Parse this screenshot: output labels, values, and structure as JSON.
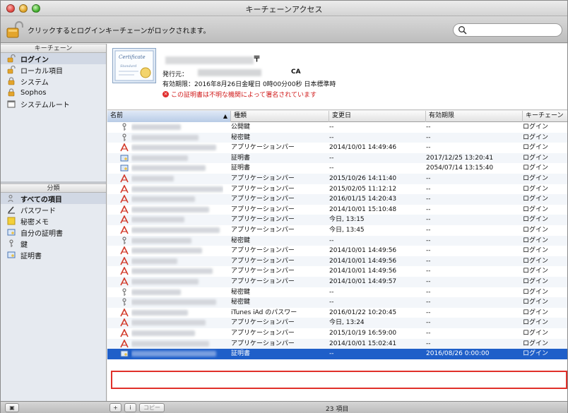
{
  "window": {
    "title": "キーチェーンアクセス"
  },
  "toolbar": {
    "lock_message": "クリックするとログインキーチェーンがロックされます。",
    "search_placeholder": "",
    "search_icon": "magnifier-icon"
  },
  "sidebar": {
    "keychains_header": "キーチェーン",
    "keychains": [
      {
        "label": "ログイン",
        "icon": "unlocked-padlock-icon",
        "selected": true
      },
      {
        "label": "ローカル項目",
        "icon": "unlocked-padlock-icon",
        "selected": false
      },
      {
        "label": "システム",
        "icon": "locked-padlock-icon",
        "selected": false
      },
      {
        "label": "Sophos",
        "icon": "locked-padlock-icon",
        "selected": false
      },
      {
        "label": "システムルート",
        "icon": "folder-icon",
        "selected": false
      }
    ],
    "category_header": "分類",
    "categories": [
      {
        "label": "すべての項目",
        "icon": "people-icon",
        "selected": true
      },
      {
        "label": "パスワード",
        "icon": "pencil-icon",
        "selected": false
      },
      {
        "label": "秘密メモ",
        "icon": "note-icon",
        "selected": false
      },
      {
        "label": "自分の証明書",
        "icon": "certificate-icon",
        "selected": false
      },
      {
        "label": "鍵",
        "icon": "key-icon",
        "selected": false
      },
      {
        "label": "証明書",
        "icon": "certificate-icon",
        "selected": false
      }
    ]
  },
  "detail": {
    "name_suffix": "〒",
    "issuer_label": "発行元：",
    "issuer_suffix": "CA",
    "expiry": "有効期限：2016年8月26日金曜日 0時00分00秒 日本標準時",
    "warning": "この証明書は不明な機関によって署名されています",
    "warning_icon": "warning-icon"
  },
  "table": {
    "columns": {
      "name": "名前",
      "kind": "種類",
      "modified": "変更日",
      "expires": "有効期限",
      "keychain": "キーチェーン"
    },
    "rows": [
      {
        "icon": "key-icon",
        "kind": "公開鍵",
        "modified": "--",
        "expires": "--",
        "keychain": "ログイン"
      },
      {
        "icon": "key-icon",
        "kind": "秘密鍵",
        "modified": "--",
        "expires": "--",
        "keychain": "ログイン"
      },
      {
        "icon": "app-pen-icon",
        "kind": "アプリケーションパー",
        "modified": "2014/10/01 14:49:46",
        "expires": "--",
        "keychain": "ログイン"
      },
      {
        "icon": "certificate-icon",
        "kind": "証明書",
        "modified": "--",
        "expires": "2017/12/25 13:20:41",
        "keychain": "ログイン"
      },
      {
        "icon": "certificate-icon",
        "kind": "証明書",
        "modified": "--",
        "expires": "2054/07/14 13:15:40",
        "keychain": "ログイン"
      },
      {
        "icon": "app-pen-icon",
        "kind": "アプリケーションパー",
        "modified": "2015/10/26 14:11:40",
        "expires": "--",
        "keychain": "ログイン"
      },
      {
        "icon": "app-pen-icon",
        "kind": "アプリケーションパー",
        "modified": "2015/02/05 11:12:12",
        "expires": "--",
        "keychain": "ログイン"
      },
      {
        "icon": "app-pen-icon",
        "kind": "アプリケーションパー",
        "modified": "2016/01/15 14:20:43",
        "expires": "--",
        "keychain": "ログイン"
      },
      {
        "icon": "app-pen-icon",
        "kind": "アプリケーションパー",
        "modified": "2014/10/01 15:10:48",
        "expires": "--",
        "keychain": "ログイン"
      },
      {
        "icon": "app-pen-icon",
        "kind": "アプリケーションパー",
        "modified": "今日, 13:15",
        "expires": "--",
        "keychain": "ログイン"
      },
      {
        "icon": "app-pen-icon",
        "kind": "アプリケーションパー",
        "modified": "今日, 13:45",
        "expires": "--",
        "keychain": "ログイン"
      },
      {
        "icon": "key-icon",
        "kind": "秘密鍵",
        "modified": "--",
        "expires": "--",
        "keychain": "ログイン"
      },
      {
        "icon": "app-pen-icon",
        "kind": "アプリケーションパー",
        "modified": "2014/10/01 14:49:56",
        "expires": "--",
        "keychain": "ログイン"
      },
      {
        "icon": "app-pen-icon",
        "kind": "アプリケーションパー",
        "modified": "2014/10/01 14:49:56",
        "expires": "--",
        "keychain": "ログイン"
      },
      {
        "icon": "app-pen-icon",
        "kind": "アプリケーションパー",
        "modified": "2014/10/01 14:49:56",
        "expires": "--",
        "keychain": "ログイン"
      },
      {
        "icon": "app-pen-icon",
        "kind": "アプリケーションパー",
        "modified": "2014/10/01 14:49:57",
        "expires": "--",
        "keychain": "ログイン"
      },
      {
        "icon": "key-icon",
        "kind": "秘密鍵",
        "modified": "--",
        "expires": "--",
        "keychain": "ログイン"
      },
      {
        "icon": "key-icon",
        "kind": "秘密鍵",
        "modified": "--",
        "expires": "--",
        "keychain": "ログイン"
      },
      {
        "icon": "app-pen-icon",
        "kind": "iTunes iAd のパスワー",
        "modified": "2016/01/22 10:20:45",
        "expires": "--",
        "keychain": "ログイン"
      },
      {
        "icon": "app-pen-icon",
        "kind": "アプリケーションパー",
        "modified": "今日, 13:24",
        "expires": "--",
        "keychain": "ログイン"
      },
      {
        "icon": "app-pen-icon",
        "kind": "アプリケーションパー",
        "modified": "2015/10/19 16:59:00",
        "expires": "--",
        "keychain": "ログイン"
      },
      {
        "icon": "app-pen-icon",
        "kind": "アプリケーションパー",
        "modified": "2014/10/01 15:02:41",
        "expires": "--",
        "keychain": "ログイン"
      },
      {
        "icon": "certificate-icon",
        "kind": "証明書",
        "modified": "--",
        "expires": "2016/08/26 0:00:00",
        "keychain": "ログイン",
        "selected": true
      }
    ]
  },
  "statusbar": {
    "info_label": "i",
    "add_label": "+",
    "copy_label": "コピー",
    "count": "23 項目"
  },
  "colors": {
    "selection": "#1f5fc9",
    "warning": "#d01818",
    "highlight_box": "#e0302a"
  }
}
